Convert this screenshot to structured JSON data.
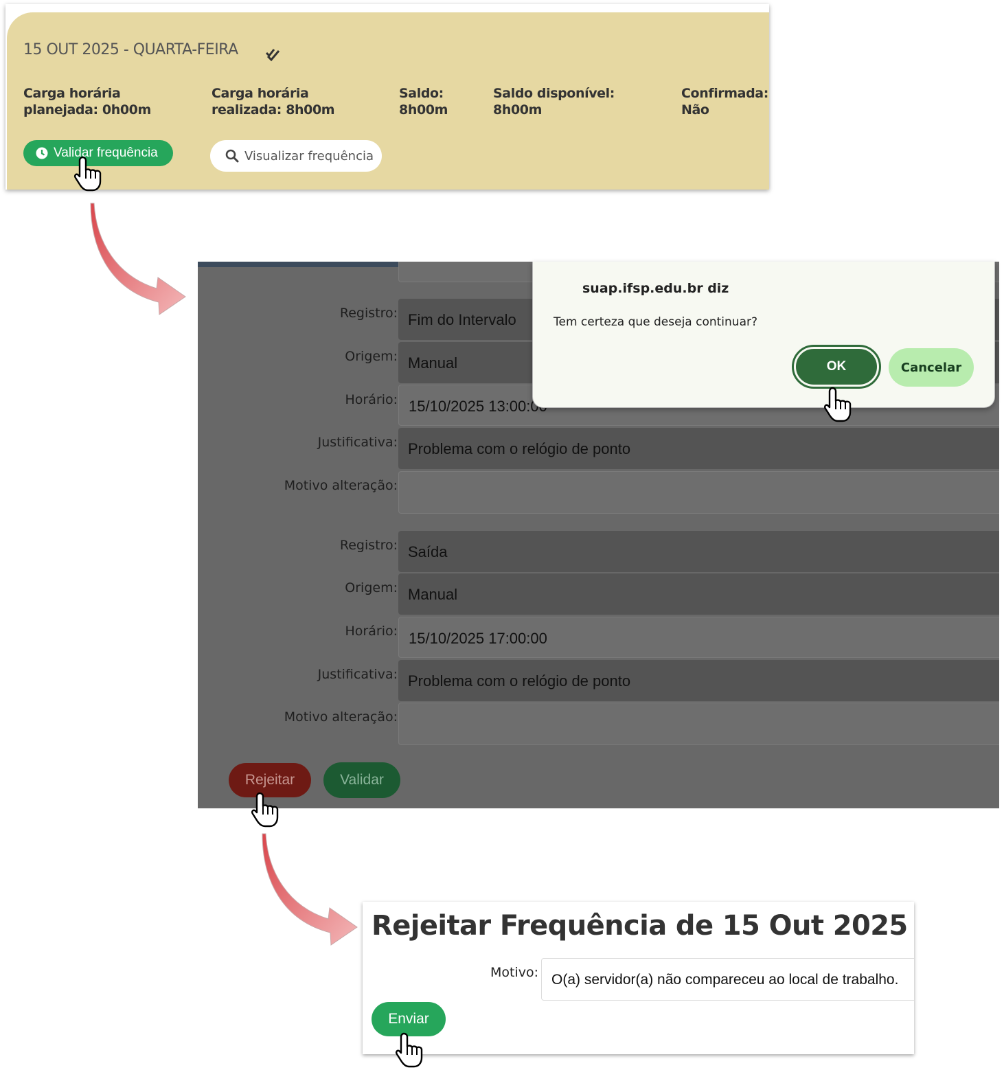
{
  "day_card": {
    "title": "15 OUT 2025 - QUARTA-FEIRA",
    "stats": [
      {
        "line1": "Carga horária",
        "line2": "planejada: 0h00m"
      },
      {
        "line1": "Carga horária",
        "line2": "realizada: 8h00m"
      },
      {
        "line1": "Saldo:",
        "line2": "8h00m"
      },
      {
        "line1": "Saldo disponível:",
        "line2": "8h00m"
      },
      {
        "line1": "Confirmada:",
        "line2": "Não"
      }
    ],
    "validate_button": "Validar frequência",
    "view_button": "Visualizar frequência",
    "colors": {
      "background": "#e6d8a2",
      "validate": "#26a65b"
    }
  },
  "record_form": {
    "records": [
      {
        "registro_label": "Registro:",
        "registro": "Fim do Intervalo",
        "origem_label": "Origem:",
        "origem": "Manual",
        "horario_label": "Horário:",
        "horario": "15/10/2025 13:00:00",
        "justificativa_label": "Justificativa:",
        "justificativa": "Problema com o relógio de ponto",
        "motivo_label": "Motivo alteração:",
        "motivo": ""
      },
      {
        "registro_label": "Registro:",
        "registro": "Saída",
        "origem_label": "Origem:",
        "origem": "Manual",
        "horario_label": "Horário:",
        "horario": "15/10/2025 17:00:00",
        "justificativa_label": "Justificativa:",
        "justificativa": "Problema com o relógio de ponto",
        "motivo_label": "Motivo alteração:",
        "motivo": ""
      }
    ],
    "reject_button": "Rejeitar",
    "validate_button": "Validar"
  },
  "confirm_dialog": {
    "title": "suap.ifsp.edu.br diz",
    "message": "Tem certeza que deseja continuar?",
    "ok_button": "OK",
    "cancel_button": "Cancelar"
  },
  "reject_form": {
    "title": "Rejeitar Frequência de 15 Out 2025",
    "motivo_label": "Motivo:",
    "motivo_value": "O(a) servidor(a) não compareceu ao local de trabalho.",
    "submit_button": "Enviar"
  }
}
